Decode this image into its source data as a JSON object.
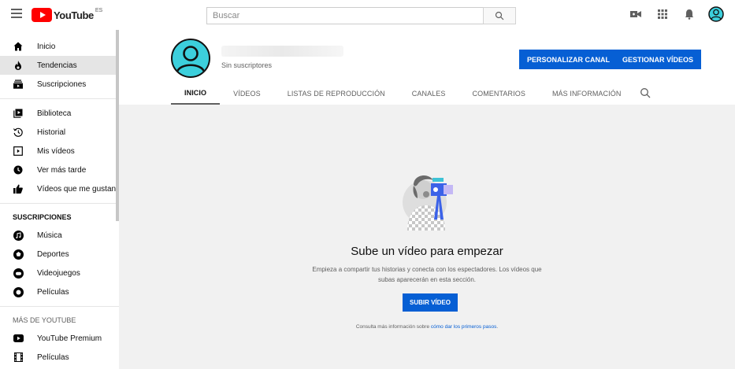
{
  "header": {
    "logo_text": "YouTube",
    "logo_region": "ES",
    "search_placeholder": "Buscar"
  },
  "sidebar": {
    "main": [
      {
        "label": "Inicio",
        "icon": "home-icon"
      },
      {
        "label": "Tendencias",
        "icon": "flame-icon",
        "active": true
      },
      {
        "label": "Suscripciones",
        "icon": "subscriptions-icon"
      }
    ],
    "library": [
      {
        "label": "Biblioteca",
        "icon": "library-icon"
      },
      {
        "label": "Historial",
        "icon": "history-icon"
      },
      {
        "label": "Mis vídeos",
        "icon": "my-videos-icon"
      },
      {
        "label": "Ver más tarde",
        "icon": "watch-later-icon"
      },
      {
        "label": "Vídeos que me gustan",
        "icon": "thumbs-up-icon"
      }
    ],
    "subscriptions_heading": "SUSCRIPCIONES",
    "subscriptions": [
      {
        "label": "Música",
        "icon": "music-icon"
      },
      {
        "label": "Deportes",
        "icon": "sports-icon"
      },
      {
        "label": "Videojuegos",
        "icon": "gaming-icon"
      },
      {
        "label": "Películas",
        "icon": "movies-icon"
      }
    ],
    "more_heading": "MÁS DE YOUTUBE",
    "more": [
      {
        "label": "YouTube Premium",
        "icon": "youtube-premium-icon"
      },
      {
        "label": "Películas",
        "icon": "film-icon"
      }
    ]
  },
  "channel": {
    "subscribers": "Sin suscriptores",
    "customize_label": "PERSONALIZAR CANAL",
    "manage_label": "GESTIONAR VÍDEOS",
    "tabs": [
      "INICIO",
      "VÍDEOS",
      "LISTAS DE REPRODUCCIÓN",
      "CANALES",
      "COMENTARIOS",
      "MÁS INFORMACIÓN"
    ]
  },
  "empty_state": {
    "title": "Sube un vídeo para empezar",
    "description": "Empieza a compartir tus historias y conecta con los espectadores. Los vídeos que subas aparecerán en esta sección.",
    "upload_label": "SUBIR VÍDEO",
    "help_prefix": "Consulta más información sobre",
    "help_link": "cómo dar los primeros pasos",
    "help_suffix": "."
  },
  "colors": {
    "accent": "#065fd4",
    "logo_red": "#ff0000",
    "avatar": "#3ccfdc"
  }
}
